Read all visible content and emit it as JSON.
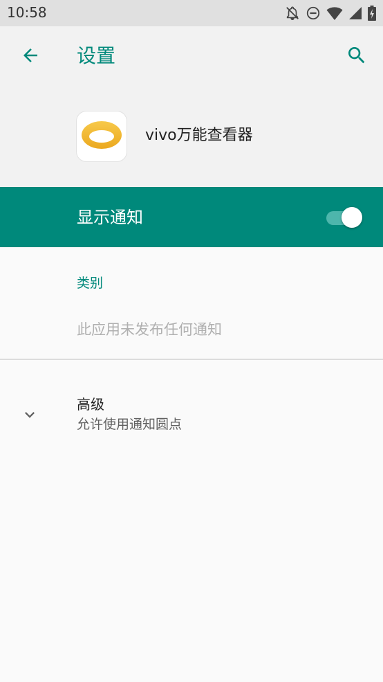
{
  "status_bar": {
    "time": "10:58",
    "icons": [
      "notifications-off-icon",
      "do-not-disturb-icon",
      "wifi-icon",
      "cellular-signal-icon",
      "battery-charging-icon"
    ]
  },
  "header": {
    "title": "设置",
    "back_icon": "arrow-back-icon",
    "search_icon": "search-icon"
  },
  "app": {
    "name": "vivo万能查看器",
    "icon": "app-eye-icon",
    "icon_color": "#f5b82e"
  },
  "master_switch": {
    "label": "显示通知",
    "checked": true
  },
  "categories": {
    "header": "类别",
    "empty_message": "此应用未发布任何通知"
  },
  "advanced": {
    "title": "高级",
    "summary": "允许使用通知圆点",
    "expand_icon": "chevron-down-icon"
  },
  "colors": {
    "accent": "#00897b",
    "status_bar": "#e0e0e0",
    "header_bg": "#f2f2f2",
    "page_bg": "#fafafa"
  }
}
